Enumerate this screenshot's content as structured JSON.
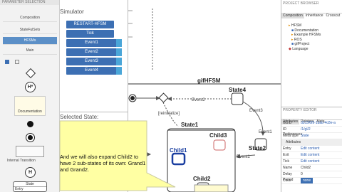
{
  "palette": {
    "header": "PARAMETER SELECTION",
    "items": [
      "Composition",
      "StateFulSets",
      "HFSMs",
      "Main"
    ],
    "selected_index": 2,
    "shapes": {
      "documentation": "Documentation",
      "internal_transition": "Internal Transition",
      "state_label": "State",
      "entry_label": "Entry"
    }
  },
  "simulator": {
    "title": "Simulator",
    "restart_label": "RESTART-HFSM",
    "tick_label": "Tick",
    "events": [
      "Event1",
      "Event2",
      "Event3",
      "Event4"
    ],
    "selected_state_title": "Selected State:"
  },
  "caption": {
    "text": "And we will also expand Child2 to have 2 sub-states of its own: Grand1 and Grand2."
  },
  "diagram": {
    "title": "gifHFSM",
    "states": {
      "state1": "State1",
      "state2": "State2",
      "state4": "State4",
      "child1": "Child1",
      "child2": "Child2",
      "child3": "Child3"
    },
    "transitions": {
      "event1": "Event1",
      "event2": "Event1",
      "event3": "Event3",
      "event4": "Event2",
      "guard": "[reinitialize]"
    }
  },
  "project_tree": {
    "header": "PROJECT BROWSER",
    "tabs": [
      "Composition",
      "Inheritance",
      "Crosscut"
    ],
    "items": [
      "HFSM",
      "Documentation",
      "Example HFSMs",
      "ROS",
      "gifProject",
      "Language"
    ]
  },
  "properties": {
    "header": "PROPERTY EDITOR",
    "tabs": [
      "Attributes",
      "Pointers",
      "Meta",
      "Preferences"
    ],
    "rows": [
      {
        "key": "GUID",
        "value": "d2c5f6f9-1bab-4c8e-a"
      },
      {
        "key": "ID",
        "value": "/1/gl/2"
      },
      {
        "key": "Meta type",
        "value": "State"
      }
    ],
    "attributes_header": "Attributes",
    "attr_rows": [
      {
        "key": "Entry",
        "value": "Edit content"
      },
      {
        "key": "Exit",
        "value": "Edit content"
      },
      {
        "key": "Tick",
        "value": "Edit content"
      },
      {
        "key": "Name",
        "value": "Child2"
      },
      {
        "key": "Delay Period",
        "value": "0"
      }
    ],
    "footer_label": "Color",
    "footer_value": "none"
  }
}
